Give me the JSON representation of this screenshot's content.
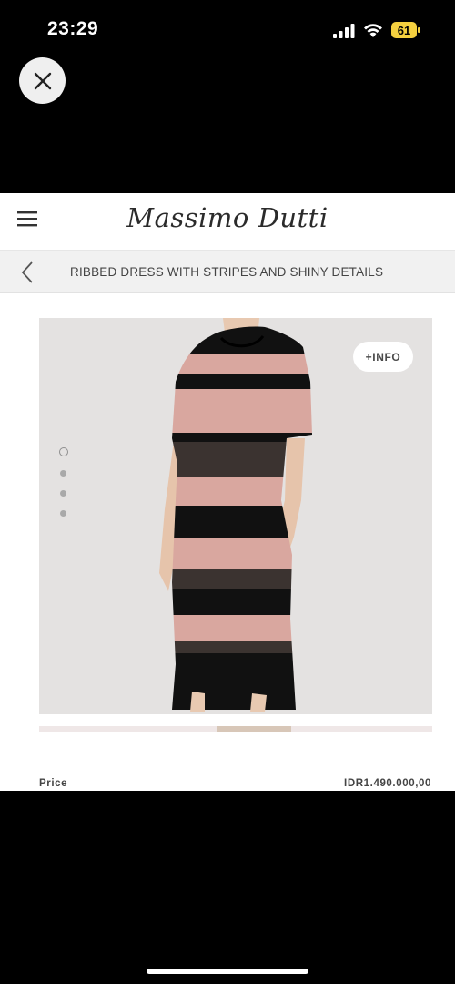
{
  "status_bar": {
    "time": "23:29",
    "battery_level": "61"
  },
  "overlay": {
    "close_icon": "close-icon"
  },
  "header": {
    "brand": "Massimo Dutti",
    "menu_icon": "hamburger-menu-icon"
  },
  "product": {
    "title": "RIBBED DRESS WITH STRIPES AND SHINY DETAILS",
    "back_icon": "chevron-left-icon",
    "info_button": "+INFO",
    "gallery": {
      "image_count": 4,
      "active_index": 0
    },
    "price_label": "Price",
    "price_value": "IDR1.490.000,00"
  },
  "colors": {
    "battery": "#f4d03f",
    "stripe_pink": "#d9a79f",
    "stripe_black": "#111111",
    "stripe_lurex": "#3b3330"
  }
}
